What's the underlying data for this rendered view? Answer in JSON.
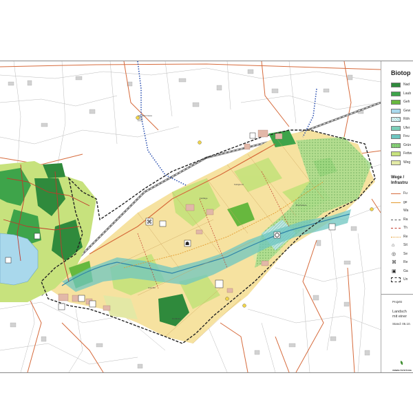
{
  "map": {
    "background_color": "#ffffff",
    "colors": {
      "nadelwald": "#2f8a3c",
      "laubwald": "#3ea44a",
      "gehoelz": "#67b83e",
      "gewaesser": "#a9d8ec",
      "roehricht": "#8fd0d6",
      "ufer": "#7ccfb9",
      "feucht": "#6dc5c0",
      "gruenland": "#8ad07a",
      "fettwiese": "#c7e27d",
      "wegrand": "#e3e9a6",
      "acker": "#f6e2a0",
      "building": "#cfcfcf",
      "road": "#d66a3b",
      "rail": "#555555",
      "boundary": "#222222",
      "path_red": "#c0392b",
      "path_orange": "#e39a2d",
      "blue_path": "#2a4fb0"
    }
  },
  "legend": {
    "title": "Biotop",
    "biotope_items": [
      {
        "label": "Nad",
        "color": "#2f8a3c",
        "pattern": "solid"
      },
      {
        "label": "Laub",
        "color": "#3ea44a",
        "pattern": "solid"
      },
      {
        "label": "Geh",
        "color": "#67b83e",
        "pattern": "solid"
      },
      {
        "label": "Gew",
        "color": "#a9d8ec",
        "pattern": "solid"
      },
      {
        "label": "Röh",
        "color": "#8fd0d6",
        "pattern": "hatched"
      },
      {
        "label": "Ufer",
        "color": "#7ccfb9",
        "pattern": "solid"
      },
      {
        "label": "Feu",
        "color": "#6dc5c0",
        "pattern": "solid"
      },
      {
        "label": "Grün",
        "color": "#8ad07a",
        "pattern": "dotted"
      },
      {
        "label": "Fettw",
        "color": "#c7e27d",
        "pattern": "solid"
      },
      {
        "label": "Weg",
        "color": "#e3e9a6",
        "pattern": "solid"
      }
    ],
    "section2_title_line1": "Wege /",
    "section2_title_line2": "Infrastru",
    "infra_items": [
      {
        "label": "Fu",
        "style": "line",
        "color": "#d66a3b"
      },
      {
        "label": "ge",
        "style": "line",
        "color": "#e39a2d"
      },
      {
        "label": "Wa",
        "style": "none",
        "color": "#ffffff"
      },
      {
        "label": "Ra",
        "style": "dashed",
        "color": "#555555"
      },
      {
        "label": "Th",
        "style": "dashed",
        "color": "#c0392b"
      },
      {
        "label": "Re",
        "style": "dotted",
        "color": "#e39a2d"
      },
      {
        "label": "Sit",
        "style": "icon",
        "icon": "bench-icon",
        "glyph": "⌂"
      },
      {
        "label": "Se",
        "style": "icon",
        "icon": "viewpoint-icon",
        "glyph": "◎"
      },
      {
        "label": "Re",
        "style": "icon",
        "icon": "rest-icon",
        "glyph": "⌘"
      },
      {
        "label": "Ga",
        "style": "icon",
        "icon": "garden-icon",
        "glyph": "▣"
      },
      {
        "label": "Un",
        "style": "dashbox",
        "color": "#222222"
      }
    ],
    "title_block": {
      "line1": "Projekt",
      "line2": "Landsch",
      "line3": "mit einer",
      "line4": "Stand: 05.10.",
      "logo_text": "UMWELTSTIFTUNG"
    }
  }
}
